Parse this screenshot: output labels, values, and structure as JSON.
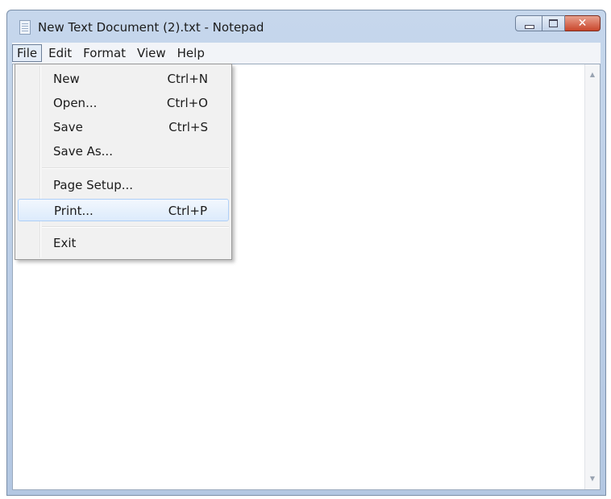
{
  "window": {
    "title": "New Text Document (2).txt - Notepad",
    "icon": "notepad-icon",
    "controls": {
      "minimize": "minimize-icon",
      "maximize": "maximize-icon",
      "close": "close-icon",
      "close_glyph": "✕"
    }
  },
  "menubar": {
    "items": [
      {
        "label": "File",
        "active": true
      },
      {
        "label": "Edit"
      },
      {
        "label": "Format"
      },
      {
        "label": "View"
      },
      {
        "label": "Help"
      }
    ]
  },
  "file_menu": {
    "items": [
      {
        "label": "New",
        "shortcut": "Ctrl+N"
      },
      {
        "label": "Open...",
        "shortcut": "Ctrl+O"
      },
      {
        "label": "Save",
        "shortcut": "Ctrl+S"
      },
      {
        "label": "Save As..."
      },
      {
        "label": "Page Setup..."
      },
      {
        "label": "Print...",
        "shortcut": "Ctrl+P",
        "highlighted": true
      },
      {
        "label": "Exit"
      }
    ]
  },
  "editor": {
    "text": "",
    "scroll_up_glyph": "▲",
    "scroll_down_glyph": "▼"
  }
}
